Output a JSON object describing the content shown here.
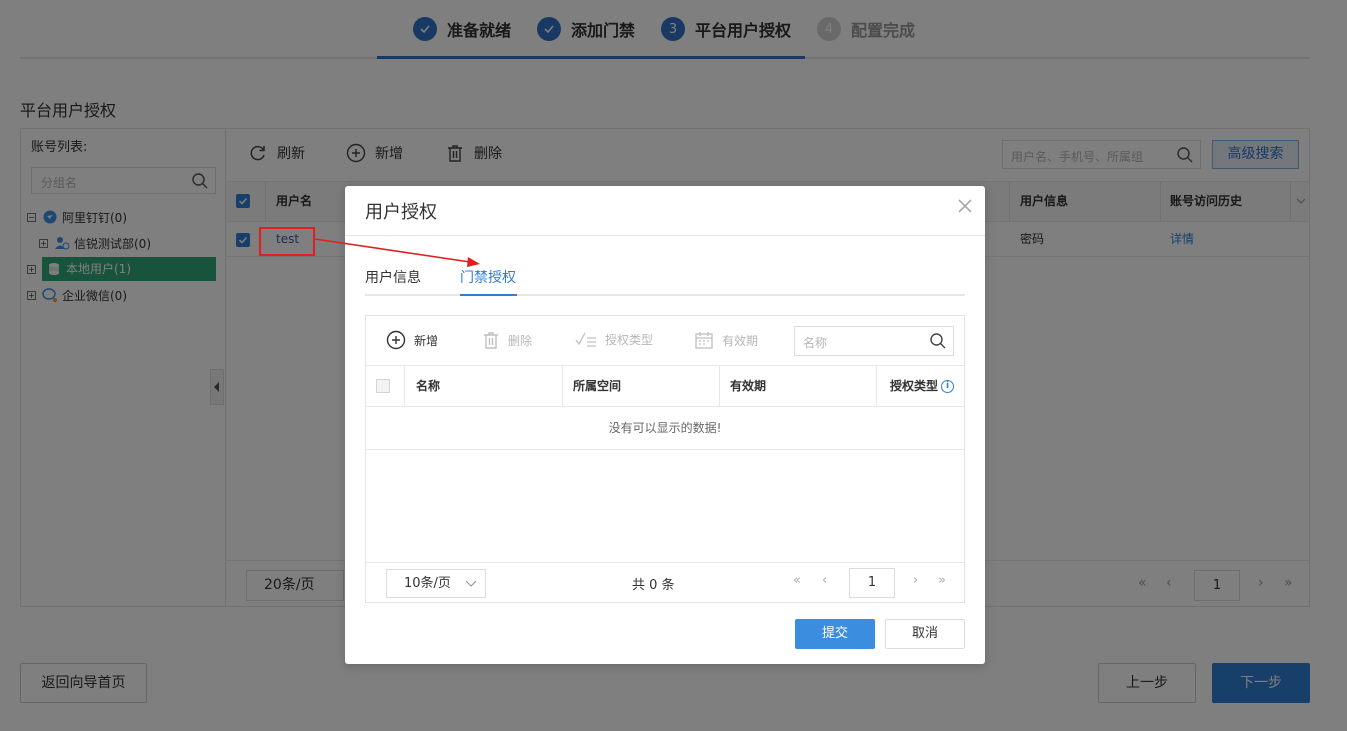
{
  "wizard": {
    "steps": [
      {
        "num": "✓",
        "label": "准备就绪",
        "state": "done"
      },
      {
        "num": "✓",
        "label": "添加门禁",
        "state": "done"
      },
      {
        "num": "3",
        "label": "平台用户授权",
        "state": "active"
      },
      {
        "num": "4",
        "label": "配置完成",
        "state": "todo"
      }
    ]
  },
  "section_title": "平台用户授权",
  "account_panel": {
    "title": "账号列表:",
    "search_placeholder": "分组名",
    "tree": [
      {
        "label": "阿里钉钉(0)",
        "icon": "dingtalk-icon"
      },
      {
        "label": "信锐测试部(0)",
        "icon": "user-group-icon"
      },
      {
        "label": "本地用户(1)",
        "icon": "database-icon",
        "selected": true
      },
      {
        "label": "企业微信(0)",
        "icon": "wecom-icon"
      }
    ]
  },
  "user_table": {
    "toolbar": {
      "refresh": "刷新",
      "add": "新增",
      "delete": "删除"
    },
    "search_placeholder": "用户名、手机号、所属组",
    "advanced_search": "高级搜索",
    "columns": {
      "username": "用户名",
      "user_info": "用户信息",
      "access_history": "账号访问历史"
    },
    "rows": [
      {
        "username": "test",
        "user_info": "密码",
        "access_history": "详情"
      }
    ],
    "page_size": "20条/页",
    "page": "1"
  },
  "footer": {
    "home": "返回向导首页",
    "prev": "上一步",
    "next": "下一步"
  },
  "modal": {
    "title": "用户授权",
    "tabs": [
      "用户信息",
      "门禁授权"
    ],
    "toolbar": {
      "add": "新增",
      "delete": "删除",
      "auth_type": "授权类型",
      "validity": "有效期"
    },
    "search_placeholder": "名称",
    "columns": {
      "name": "名称",
      "space": "所属空间",
      "validity": "有效期",
      "auth_type": "授权类型"
    },
    "empty_text": "没有可以显示的数据!",
    "page_size": "10条/页",
    "total": "共 0 条",
    "page": "1",
    "submit": "提交",
    "cancel": "取消"
  },
  "colors": {
    "primary": "#2f7fd3",
    "selected_tree": "#2fa876",
    "annotation": "#e02020"
  }
}
